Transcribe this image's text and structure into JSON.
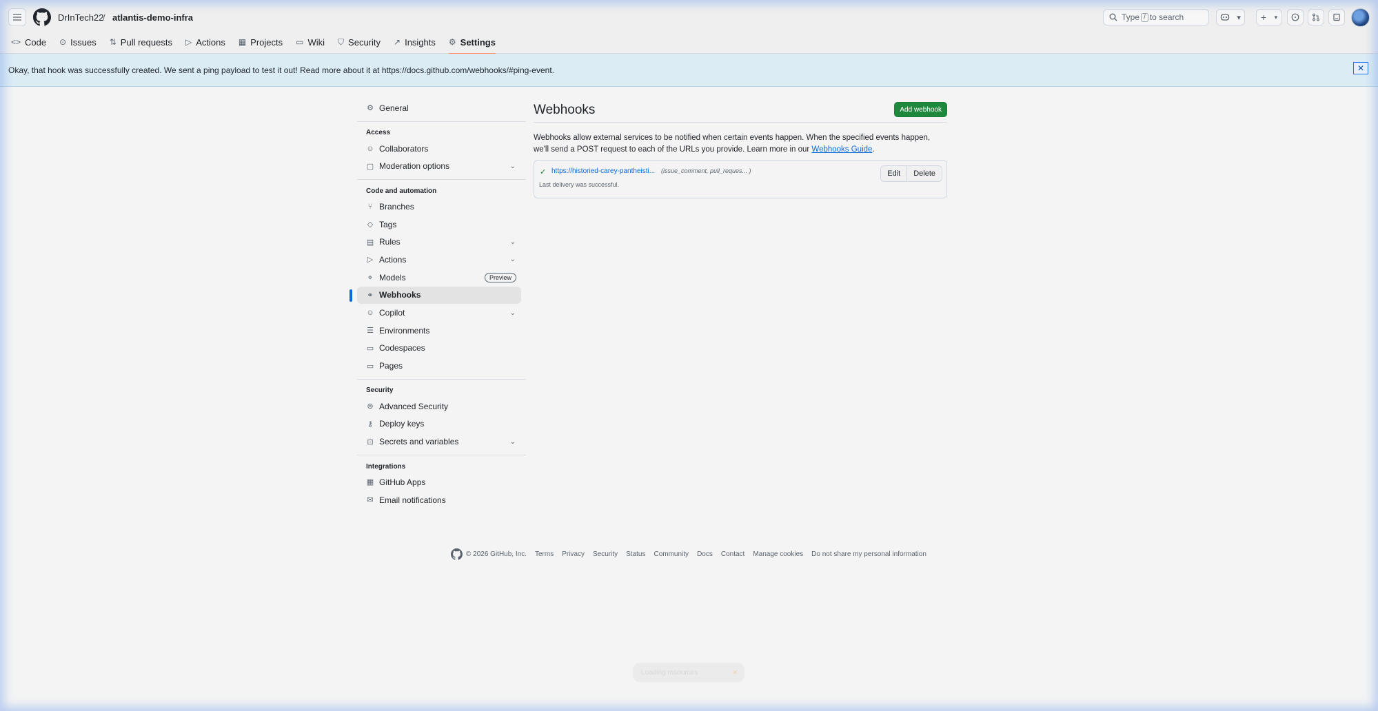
{
  "header": {
    "owner": "DrInTech22",
    "separator": "/",
    "repo": "atlantis-demo-infra",
    "search": {
      "before": "Type",
      "key": "/",
      "after": "to search"
    },
    "plus": "+",
    "caret": "▾"
  },
  "nav": [
    {
      "label": "Code",
      "icon": "code-icon"
    },
    {
      "label": "Issues",
      "icon": "issue-icon"
    },
    {
      "label": "Pull requests",
      "icon": "pull-request-icon"
    },
    {
      "label": "Actions",
      "icon": "play-icon"
    },
    {
      "label": "Projects",
      "icon": "table-icon"
    },
    {
      "label": "Wiki",
      "icon": "book-icon"
    },
    {
      "label": "Security",
      "icon": "shield-icon"
    },
    {
      "label": "Insights",
      "icon": "graph-icon"
    },
    {
      "label": "Settings",
      "icon": "gear-icon",
      "active": true
    }
  ],
  "flash": {
    "message": "Okay, that hook was successfully created. We sent a ping payload to test it out! Read more about it at https://docs.github.com/webhooks/#ping-event.",
    "close": "✕"
  },
  "sidebar": {
    "general": "General",
    "access_heading": "Access",
    "access": [
      "Collaborators",
      "Moderation options"
    ],
    "code_heading": "Code and automation",
    "code": [
      "Branches",
      "Tags",
      "Rules",
      "Actions",
      "Models",
      "Webhooks",
      "Copilot",
      "Environments",
      "Codespaces",
      "Pages"
    ],
    "models_badge": "Preview",
    "security_heading": "Security",
    "security": [
      "Advanced Security",
      "Deploy keys",
      "Secrets and variables"
    ],
    "integrations_heading": "Integrations",
    "integrations": [
      "GitHub Apps",
      "Email notifications"
    ]
  },
  "main": {
    "title": "Webhooks",
    "add_button": "Add webhook",
    "intro_1": "Webhooks allow external services to be notified when certain events happen. When the specified events happen, we'll send a POST request to each of the URLs you provide. Learn more in our ",
    "intro_link": "Webhooks Guide",
    "intro_2": ".",
    "hook": {
      "url": "https://historied-carey-pantheisti...",
      "events": "(issue_comment, pull_reques... )",
      "status": "Last delivery was successful.",
      "edit": "Edit",
      "delete": "Delete"
    }
  },
  "footer": {
    "copyright": "© 2026 GitHub, Inc.",
    "links": [
      "Terms",
      "Privacy",
      "Security",
      "Status",
      "Community",
      "Docs",
      "Contact",
      "Manage cookies",
      "Do not share my personal information"
    ]
  },
  "toast": {
    "text": "Loading resources"
  }
}
